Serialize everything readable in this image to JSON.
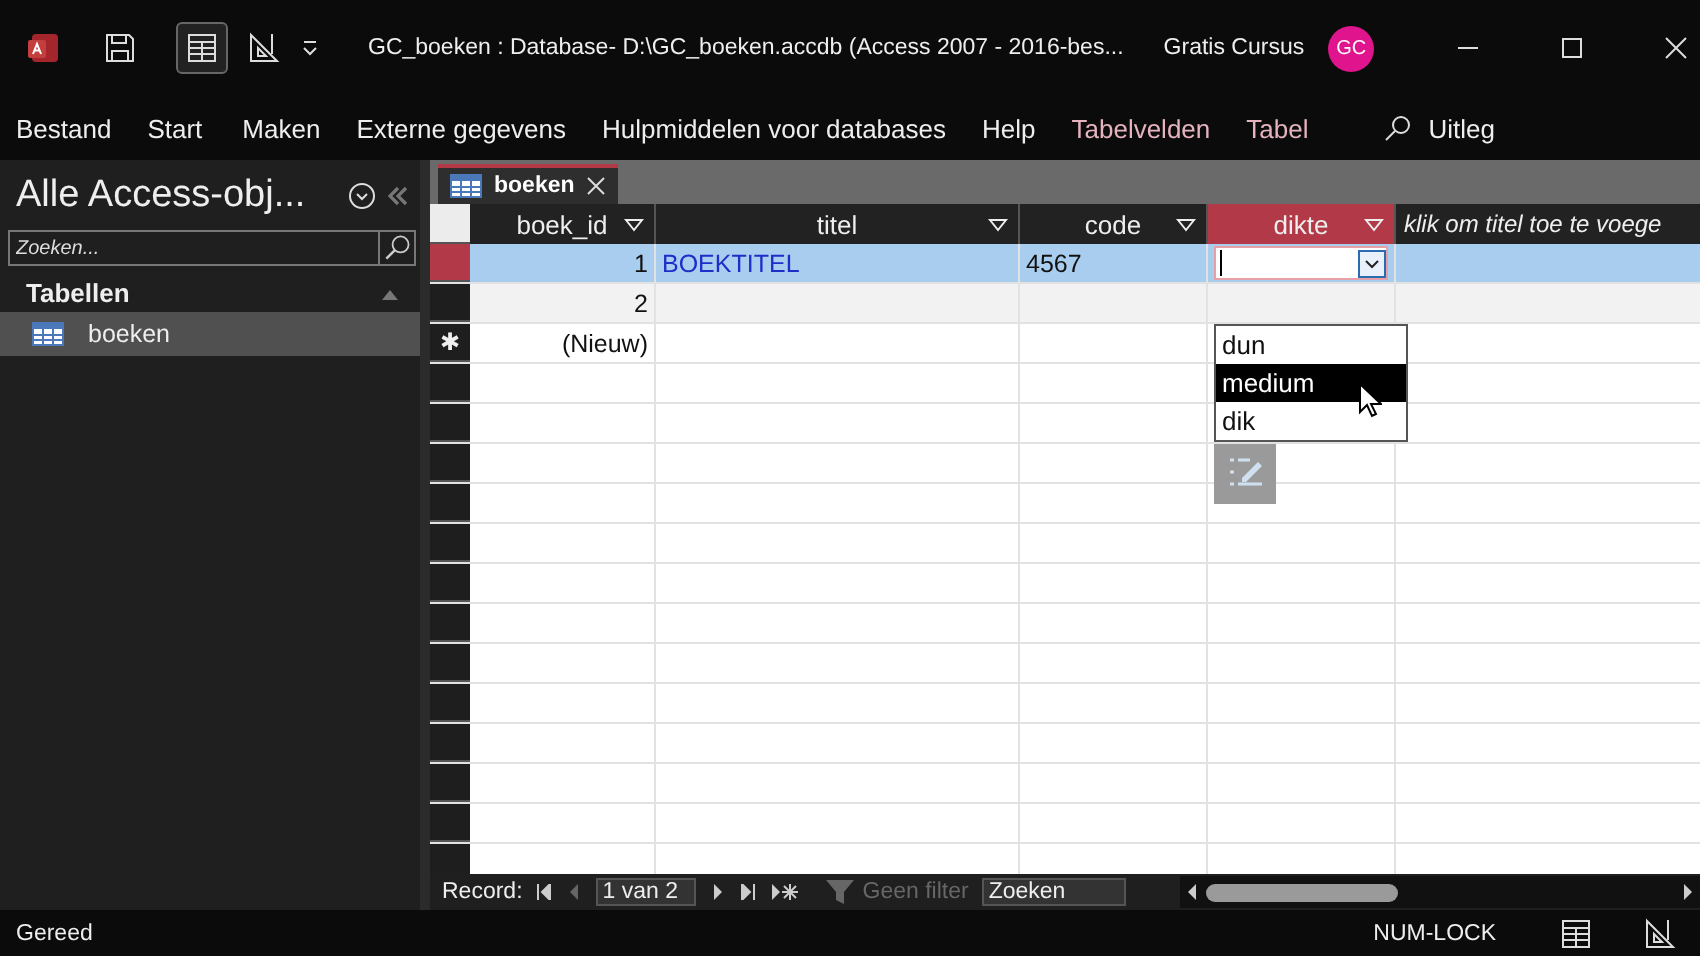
{
  "window": {
    "title": "GC_boeken : Database- D:\\GC_boeken.accdb (Access 2007 - 2016-bes...",
    "account_name": "Gratis Cursus",
    "account_initials": "GC"
  },
  "ribbon_tabs": [
    {
      "label": "Bestand",
      "kind": "normal"
    },
    {
      "label": "Start",
      "kind": "normal"
    },
    {
      "label": "Maken",
      "kind": "normal"
    },
    {
      "label": "Externe gegevens",
      "kind": "normal"
    },
    {
      "label": "Hulpmiddelen voor databases",
      "kind": "normal"
    },
    {
      "label": "Help",
      "kind": "normal"
    },
    {
      "label": "Tabelvelden",
      "kind": "contextual"
    },
    {
      "label": "Tabel",
      "kind": "contextual"
    }
  ],
  "tell_me": "Uitleg",
  "nav_pane": {
    "title": "Alle Access-obj...",
    "search_placeholder": "Zoeken...",
    "groups": [
      {
        "label": "Tabellen",
        "items": [
          {
            "label": "boeken",
            "selected": true
          }
        ]
      }
    ]
  },
  "document_tab": {
    "label": "boeken"
  },
  "table": {
    "columns": [
      {
        "label": "boek_id",
        "kind": "field",
        "selected": false
      },
      {
        "label": "titel",
        "kind": "field",
        "selected": false
      },
      {
        "label": "code",
        "kind": "field",
        "selected": false
      },
      {
        "label": "dikte",
        "kind": "field",
        "selected": true
      },
      {
        "label": "klik om titel toe te voege",
        "kind": "add",
        "selected": false
      }
    ],
    "rows": [
      {
        "cells": [
          "1",
          "BOEKTITEL",
          "4567"
        ],
        "selected": true,
        "kind": "record"
      },
      {
        "cells": [
          "2"
        ],
        "selected": false,
        "kind": "record"
      },
      {
        "cells": [
          "(Nieuw)"
        ],
        "selected": false,
        "kind": "new",
        "marker": "✱"
      }
    ]
  },
  "dropdown": {
    "options": [
      {
        "label": "dun",
        "selected": false
      },
      {
        "label": "medium",
        "selected": true
      },
      {
        "label": "dik",
        "selected": false
      }
    ]
  },
  "record_nav": {
    "label": "Record:",
    "position": "1 van 2",
    "filter": "Geen filter",
    "filter_disabled": true,
    "search": "Zoeken"
  },
  "status_bar": {
    "text": "Gereed",
    "indicator": "NUM-LOCK"
  }
}
